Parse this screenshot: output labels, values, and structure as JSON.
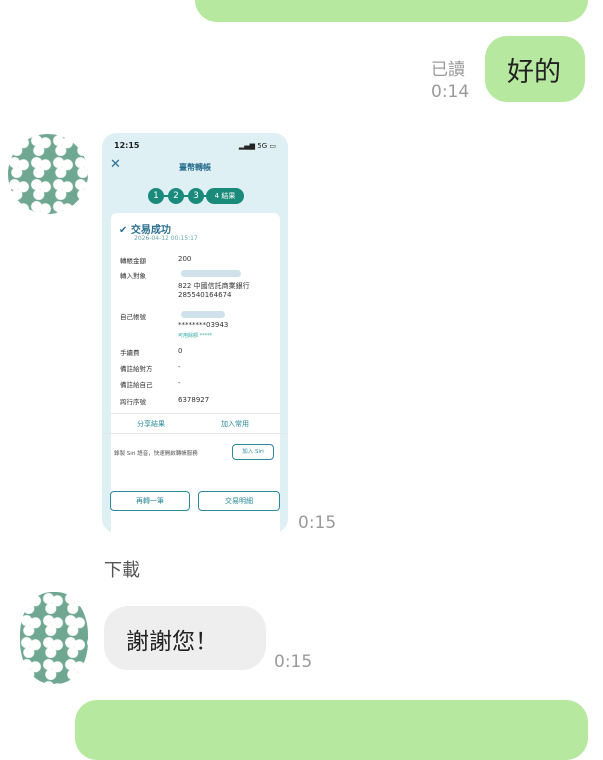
{
  "messages": {
    "m1": {
      "read": "已讀",
      "time": "0:14",
      "text": "好的"
    },
    "m2": {
      "time": "0:15",
      "download": "下載",
      "screenshot": {
        "status_time": "12:15",
        "status_signal": "5G",
        "screen_title": "臺幣轉帳",
        "steps": [
          "1",
          "2",
          "3",
          "4 結果"
        ],
        "success": "交易成功",
        "datetime": "2026-04-12 00:15:17",
        "rows": {
          "amount_label": "轉帳金額",
          "amount": "200",
          "target_label": "轉入對象",
          "bank": "822 中國信託商業銀行",
          "account": "285540164674",
          "own_label": "自己帳號",
          "own_account": "********03943",
          "available": "可用餘額 *****",
          "fee_label": "手續費",
          "fee": "0",
          "note_other_label": "備註給對方",
          "note_other": "-",
          "note_self_label": "備註給自己",
          "note_self": "-",
          "serial_label": "跨行序號",
          "serial": "6378927"
        },
        "share_result": "分享結果",
        "add_common": "加入常用",
        "siri_text": "錄製 Siri 語音，快速開啟轉帳服務",
        "add_siri": "加入 Siri",
        "transfer_again": "再轉一筆",
        "transaction_details": "交易明細"
      }
    },
    "m3": {
      "time": "0:15",
      "text": "謝謝您！"
    }
  },
  "colors": {
    "sent_bubble": "#b6e89f",
    "received_bubble": "#eeeeee",
    "time_text": "#9a9a9a"
  }
}
